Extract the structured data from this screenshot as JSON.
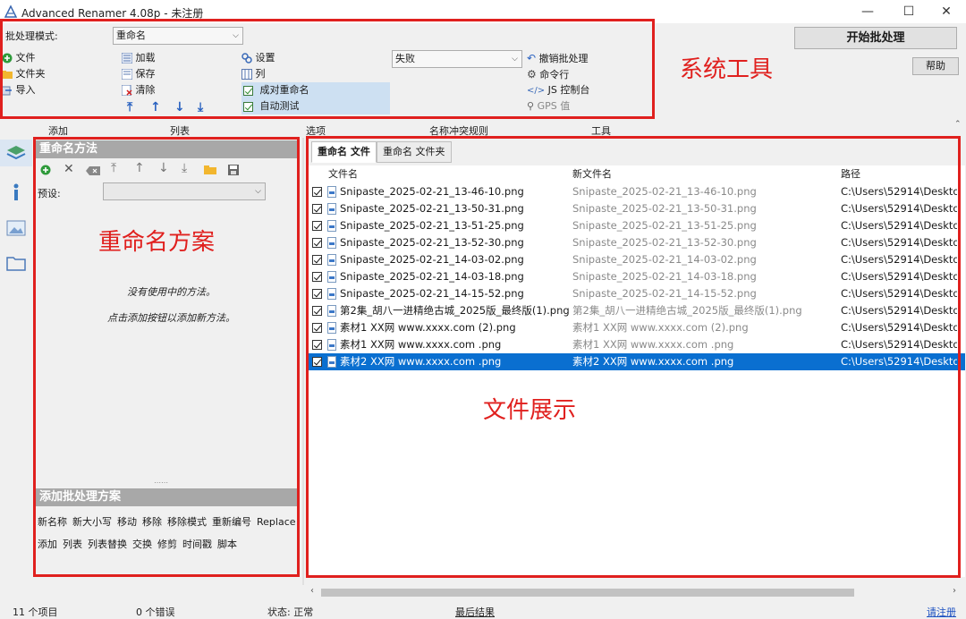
{
  "window": {
    "title": "Advanced Renamer 4.08p - 未注册",
    "minimize": "—",
    "maximize": "☐",
    "close": "✕"
  },
  "toolbar": {
    "batch_mode_label": "批处理模式:",
    "batch_mode_value": "重命名",
    "file_menu": [
      "文件",
      "文件夹",
      "导入"
    ],
    "list_menu": [
      "加载",
      "保存",
      "清除"
    ],
    "settings_menu": [
      "设置",
      "列"
    ],
    "options_checks": [
      "成对重命名",
      "自动测试"
    ],
    "conflict_value": "失败",
    "tools_menu": [
      "撤销批处理",
      "命令行",
      "JS 控制台",
      "GPS 值"
    ],
    "start_button": "开始批处理",
    "help_button": "帮助",
    "section_labels": [
      "添加",
      "列表",
      "选项",
      "名称冲突规则",
      "工具"
    ]
  },
  "annotations": {
    "system_tools": "系统工具",
    "rename_scheme": "重命名方案",
    "file_display": "文件展示"
  },
  "methods_panel": {
    "header": "重命名方法",
    "preset_label": "预设:",
    "empty_line1": "没有使用中的方法。",
    "empty_line2": "点击添加按钮以添加新方法。"
  },
  "add_panel": {
    "header": "添加批处理方案",
    "row1": [
      "新名称",
      "新大小写",
      "移动",
      "移除",
      "移除模式",
      "重新编号",
      "Replace"
    ],
    "row2": [
      "添加",
      "列表",
      "列表替换",
      "交换",
      "修剪",
      "时间戳",
      "脚本"
    ]
  },
  "tabs": [
    "重命名 文件",
    "重命名 文件夹"
  ],
  "table": {
    "columns": [
      "文件名",
      "新文件名",
      "路径"
    ],
    "rows": [
      {
        "name": "Snipaste_2025-02-21_13-46-10.png",
        "new": "Snipaste_2025-02-21_13-46-10.png",
        "path": "C:\\Users\\52914\\Deskto..."
      },
      {
        "name": "Snipaste_2025-02-21_13-50-31.png",
        "new": "Snipaste_2025-02-21_13-50-31.png",
        "path": "C:\\Users\\52914\\Deskto..."
      },
      {
        "name": "Snipaste_2025-02-21_13-51-25.png",
        "new": "Snipaste_2025-02-21_13-51-25.png",
        "path": "C:\\Users\\52914\\Deskto..."
      },
      {
        "name": "Snipaste_2025-02-21_13-52-30.png",
        "new": "Snipaste_2025-02-21_13-52-30.png",
        "path": "C:\\Users\\52914\\Deskto..."
      },
      {
        "name": "Snipaste_2025-02-21_14-03-02.png",
        "new": "Snipaste_2025-02-21_14-03-02.png",
        "path": "C:\\Users\\52914\\Deskto..."
      },
      {
        "name": "Snipaste_2025-02-21_14-03-18.png",
        "new": "Snipaste_2025-02-21_14-03-18.png",
        "path": "C:\\Users\\52914\\Deskto..."
      },
      {
        "name": "Snipaste_2025-02-21_14-15-52.png",
        "new": "Snipaste_2025-02-21_14-15-52.png",
        "path": "C:\\Users\\52914\\Deskto..."
      },
      {
        "name": "第2集_胡八一进精绝古城_2025版_最终版(1).png",
        "new": "第2集_胡八一进精绝古城_2025版_最终版(1).png",
        "path": "C:\\Users\\52914\\Deskto..."
      },
      {
        "name": "素材1  XX网 www.xxxx.com (2).png",
        "new": "素材1  XX网 www.xxxx.com (2).png",
        "path": "C:\\Users\\52914\\Deskto..."
      },
      {
        "name": "素材1  XX网 www.xxxx.com .png",
        "new": "素材1  XX网 www.xxxx.com .png",
        "path": "C:\\Users\\52914\\Deskto..."
      },
      {
        "name": "素材2  XX网 www.xxxx.com .png",
        "new": "素材2  XX网 www.xxxx.com .png",
        "path": "C:\\Users\\52914\\Deskto..."
      }
    ],
    "selected_index": 10
  },
  "status": {
    "items": "11  个项目",
    "errors": "0  个错误",
    "state": "状态: 正常",
    "last_result": "最后结果",
    "register": "请注册"
  },
  "colors": {
    "annotation_red": "#e0201e",
    "selection_blue": "#0a6fd0",
    "panel_header_gray": "#a8a8a8",
    "check_row_blue": "#cde0f2"
  }
}
